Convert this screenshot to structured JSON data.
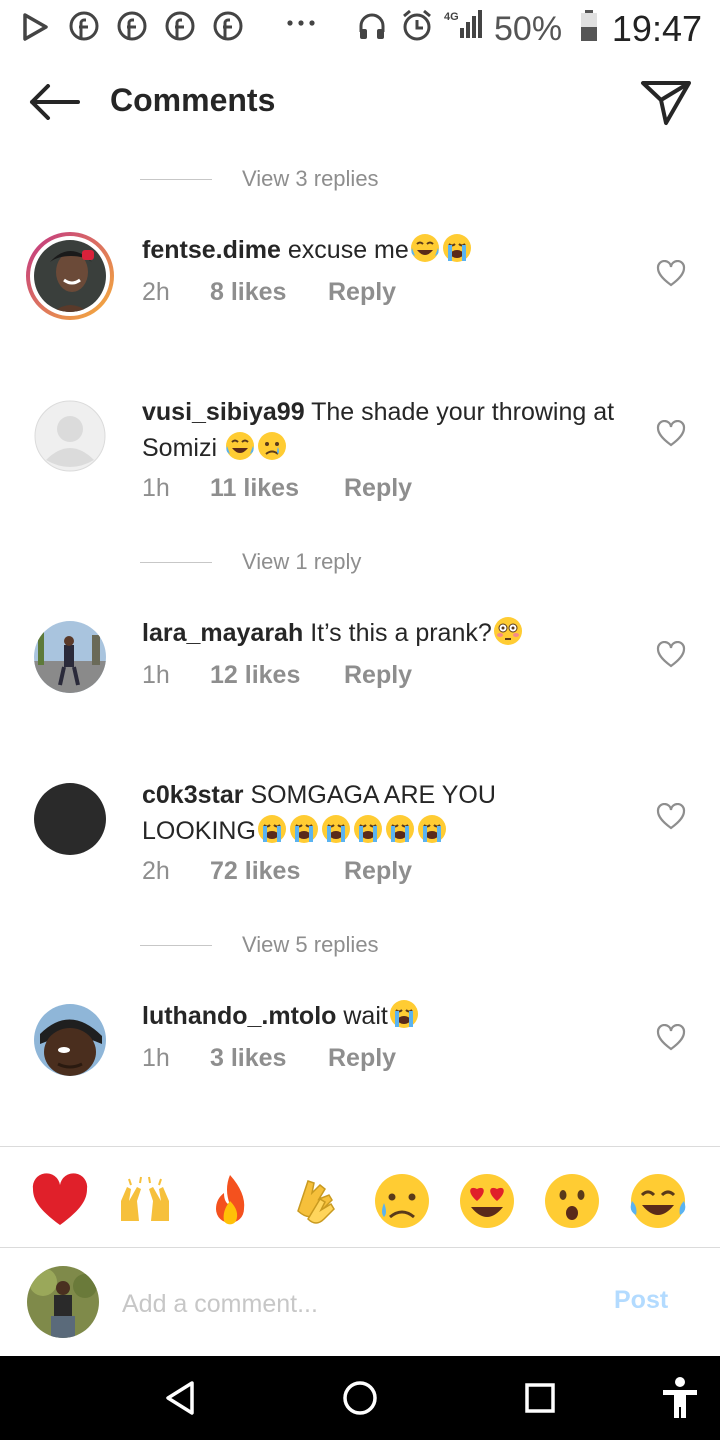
{
  "status_bar": {
    "battery_percent": "50%",
    "time": "19:47",
    "network": "4G",
    "icons": [
      "play-store-icon",
      "facebook-icon",
      "facebook-icon",
      "facebook-icon",
      "facebook-icon",
      "more-dots-icon",
      "headphones-icon",
      "alarm-icon",
      "signal-icon",
      "battery-icon"
    ]
  },
  "header": {
    "title": "Comments",
    "back_icon": "arrow-left-icon",
    "share_icon": "send-icon"
  },
  "thread": {
    "view_replies_1": "View 3 replies",
    "view_replies_2": "View 1 reply",
    "view_replies_3": "View 5 replies"
  },
  "comments": [
    {
      "username": "fentse.dime",
      "text": "excuse me",
      "emojis": [
        "face-with-tears-of-joy",
        "loudly-crying-face"
      ],
      "time": "2h",
      "likes": "8 likes",
      "reply": "Reply"
    },
    {
      "username": "vusi_sibiya99",
      "text": "The shade your throwing at Somizi ",
      "emojis": [
        "face-with-tears-of-joy",
        "sad-but-relieved-face"
      ],
      "time": "1h",
      "likes": "11 likes",
      "reply": "Reply"
    },
    {
      "username": "lara_mayarah",
      "text": "It’s this a prank?",
      "emojis": [
        "flushed-face"
      ],
      "time": "1h",
      "likes": "12 likes",
      "reply": "Reply"
    },
    {
      "username": "c0k3star",
      "text": "SOMGAGA ARE YOU LOOKING",
      "emojis": [
        "loudly-crying-face",
        "loudly-crying-face",
        "loudly-crying-face",
        "loudly-crying-face",
        "loudly-crying-face",
        "loudly-crying-face"
      ],
      "time": "2h",
      "likes": "72 likes",
      "reply": "Reply"
    },
    {
      "username": "luthando_.mtolo",
      "text": "wait",
      "emojis": [
        "loudly-crying-face"
      ],
      "time": "1h",
      "likes": "3 likes",
      "reply": "Reply"
    }
  ],
  "reactions": [
    "red-heart",
    "raising-hands",
    "fire",
    "clapping-hands",
    "sad-but-relieved-face",
    "smiling-face-with-heart-eyes",
    "face-with-open-mouth",
    "face-with-tears-of-joy"
  ],
  "add_comment": {
    "placeholder": "Add a comment...",
    "post_label": "Post"
  },
  "colors": {
    "accent_link": "#b3dbff",
    "muted_text": "#8e8e8e",
    "story_ring_start": "#c13584",
    "story_ring_end": "#f7b03a"
  }
}
